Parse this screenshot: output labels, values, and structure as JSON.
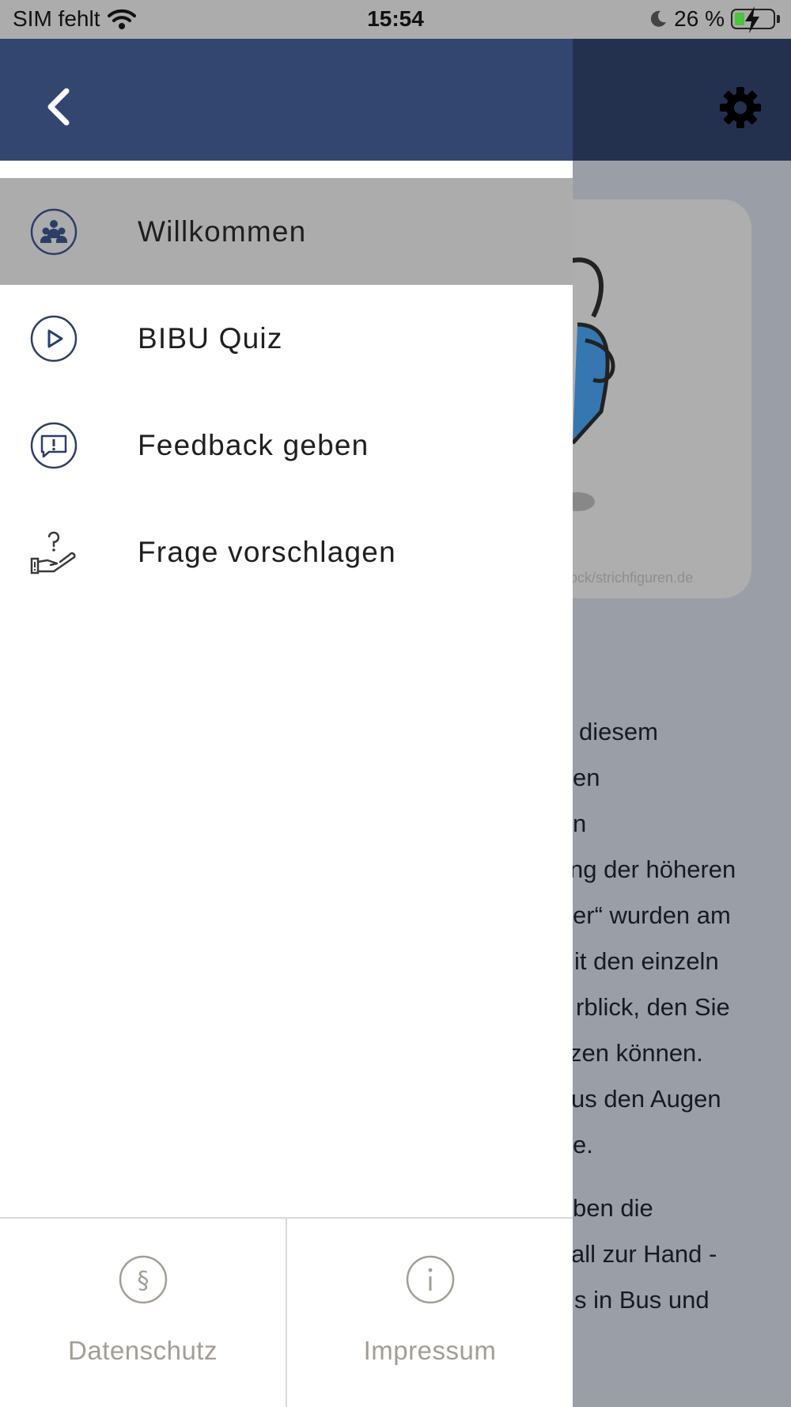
{
  "status_bar": {
    "carrier": "SIM fehlt",
    "time": "15:54",
    "battery": "26 %",
    "battery_level": 0.26
  },
  "drawer": {
    "menu": [
      {
        "label": "Willkommen",
        "icon": "group-icon",
        "active": true
      },
      {
        "label": "BIBU Quiz",
        "icon": "play-icon",
        "active": false
      },
      {
        "label": "Feedback geben",
        "icon": "feedback-icon",
        "active": false
      },
      {
        "label": "Frage vorschlagen",
        "icon": "question-hand-icon",
        "active": false
      }
    ],
    "footer": [
      {
        "label": "Datenschutz",
        "icon": "paragraph-icon"
      },
      {
        "label": "Impressum",
        "icon": "info-icon"
      }
    ]
  },
  "background": {
    "image_credit": "ock/strichfiguren.de",
    "text_lines": [
      "diesem",
      "en",
      "n",
      "ng der höheren",
      "er“ wurden am",
      "it den einzeln",
      "rblick, den Sie",
      "zen können.",
      "us den Augen",
      "e."
    ],
    "text_lines_2": [
      "ben die",
      "all zur Hand -",
      "s in Bus und"
    ]
  },
  "colors": {
    "drawer_header": "#32466f",
    "active_item": "#acacac",
    "icon_stroke": "#2d3e66",
    "footer_text": "#a39d95"
  }
}
